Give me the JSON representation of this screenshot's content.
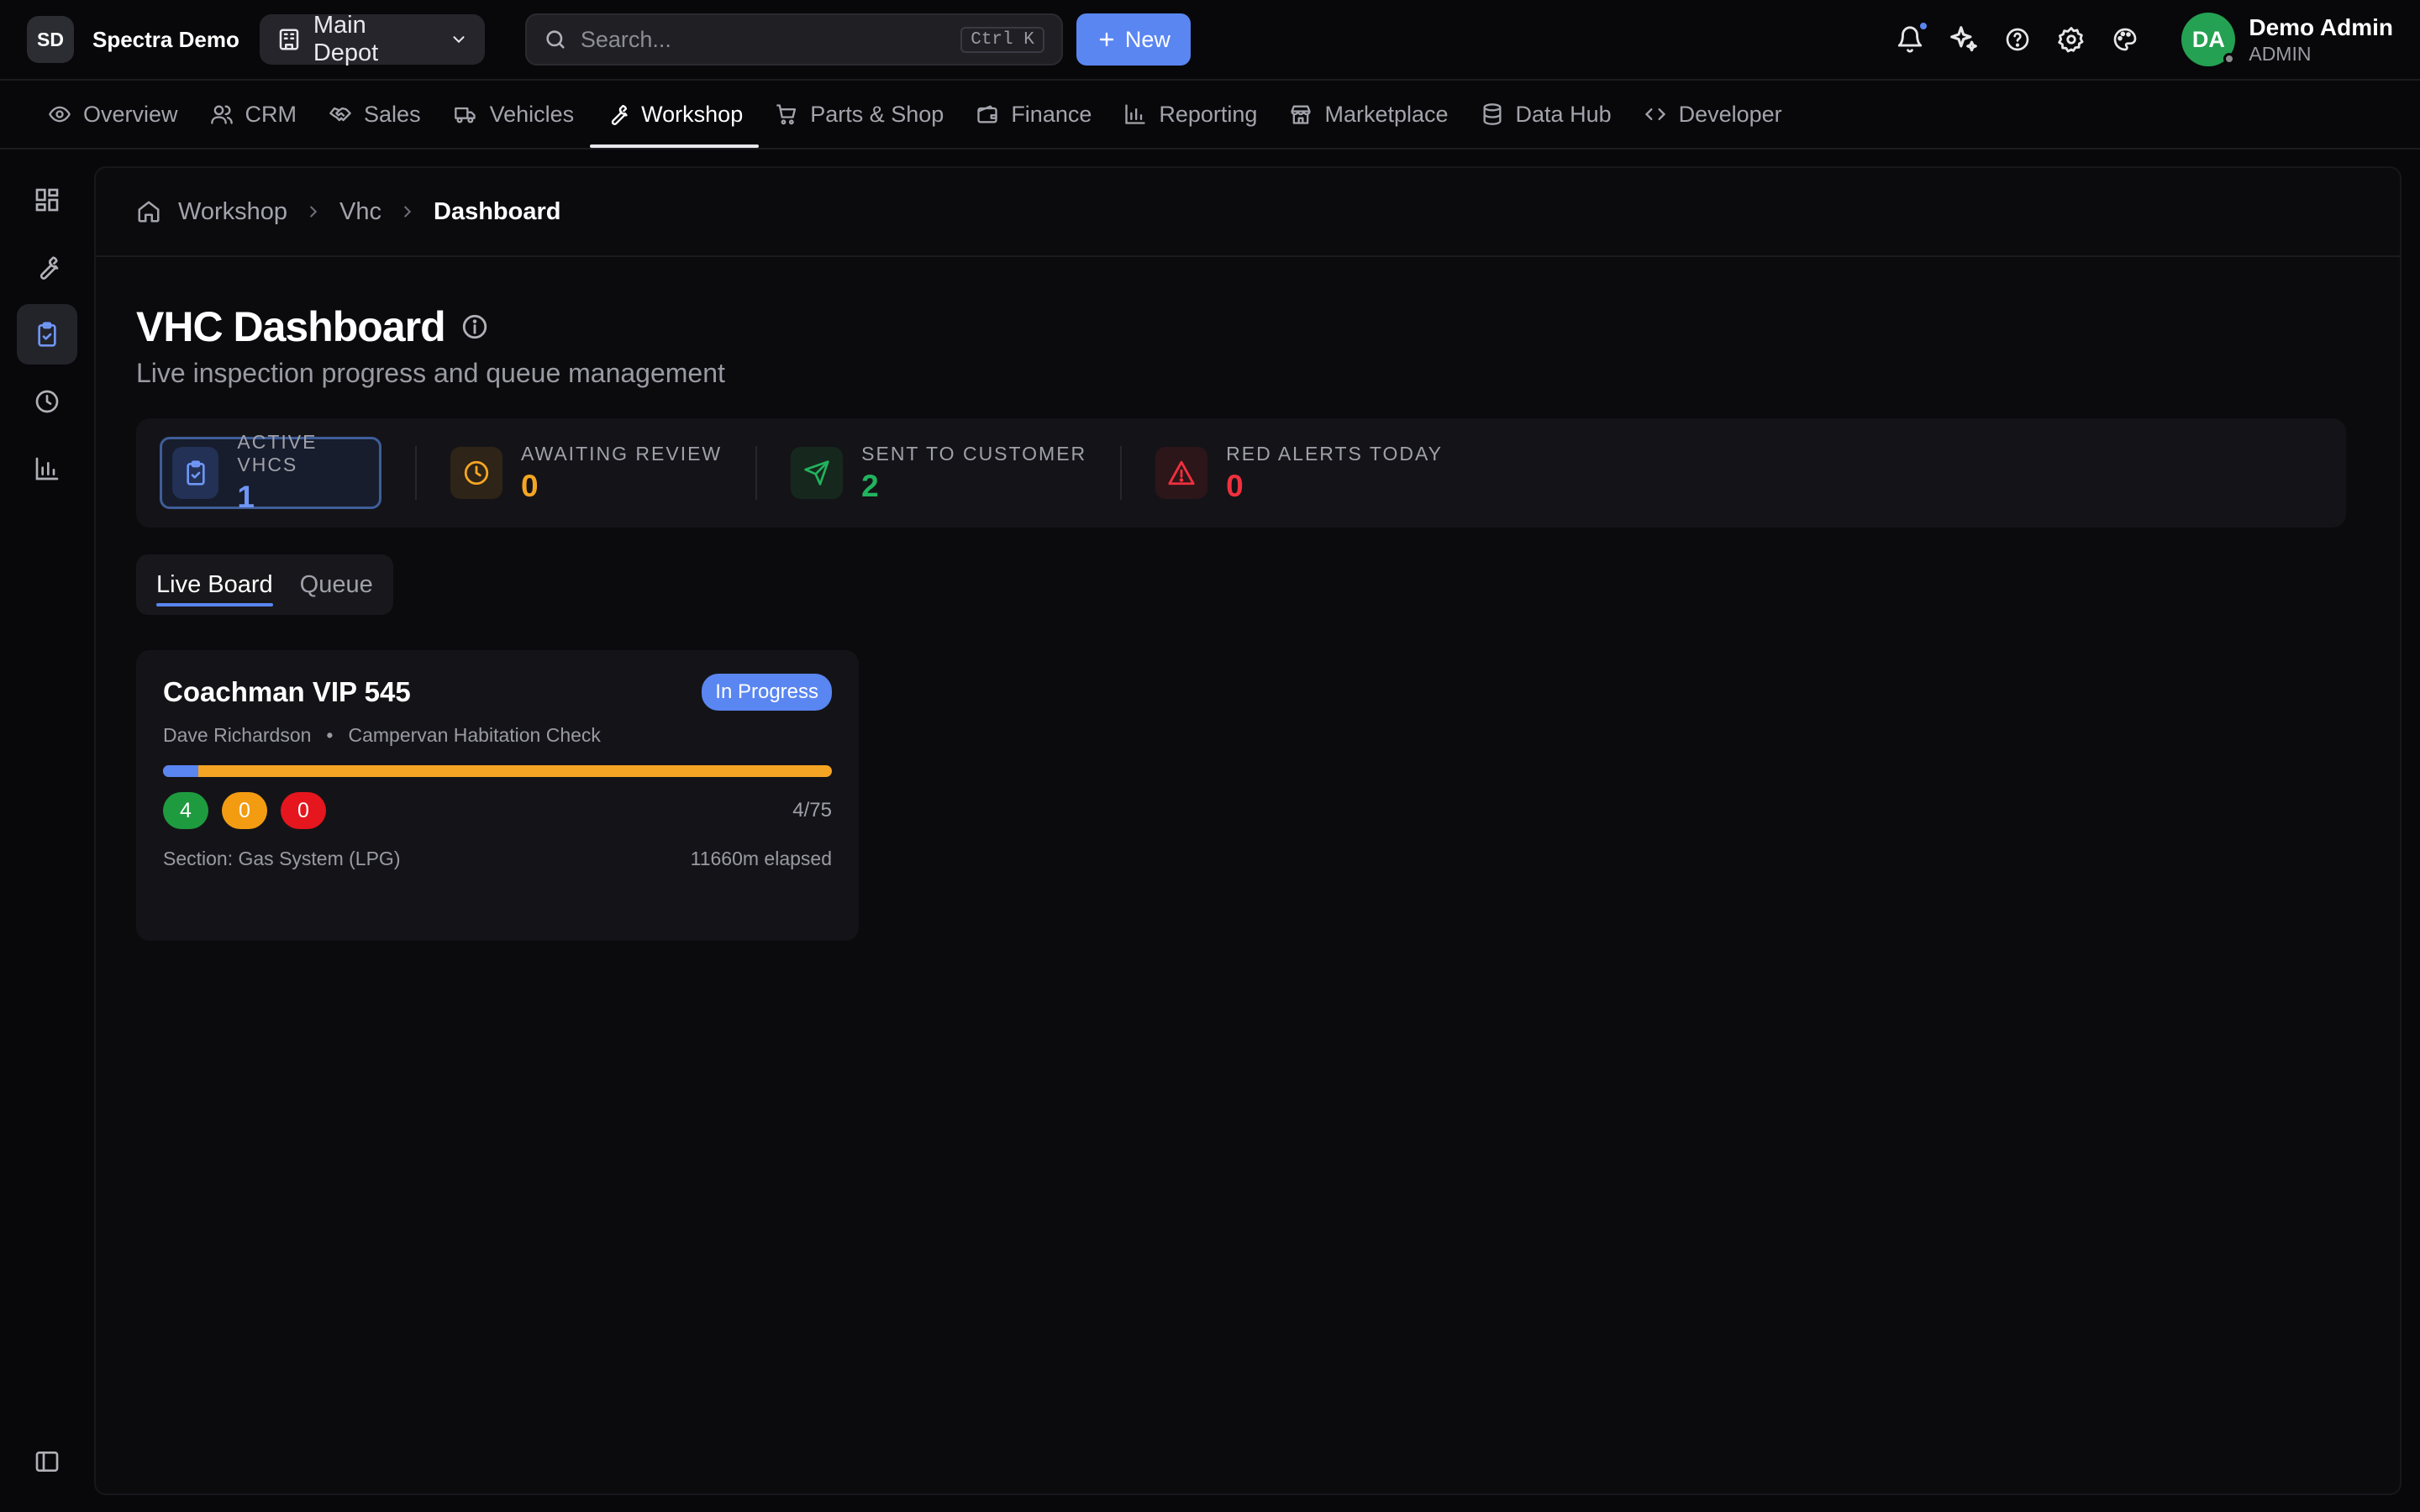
{
  "brand": {
    "initials": "SD",
    "name": "Spectra Demo"
  },
  "depot": {
    "label": "Main Depot"
  },
  "search": {
    "placeholder": "Search...",
    "shortcut": "Ctrl K"
  },
  "new_button": {
    "label": "New"
  },
  "user": {
    "initials": "DA",
    "name": "Demo Admin",
    "role": "ADMIN"
  },
  "nav": {
    "items": [
      {
        "label": "Overview",
        "icon": "eye-icon"
      },
      {
        "label": "CRM",
        "icon": "users-icon"
      },
      {
        "label": "Sales",
        "icon": "handshake-icon"
      },
      {
        "label": "Vehicles",
        "icon": "truck-icon"
      },
      {
        "label": "Workshop",
        "icon": "wrench-icon",
        "active": true
      },
      {
        "label": "Parts & Shop",
        "icon": "cart-icon"
      },
      {
        "label": "Finance",
        "icon": "wallet-icon"
      },
      {
        "label": "Reporting",
        "icon": "bar-chart-icon"
      },
      {
        "label": "Marketplace",
        "icon": "store-icon"
      },
      {
        "label": "Data Hub",
        "icon": "database-icon"
      },
      {
        "label": "Developer",
        "icon": "code-icon"
      }
    ]
  },
  "sidebar": {
    "items": [
      {
        "icon": "grid-icon"
      },
      {
        "icon": "wrench-icon"
      },
      {
        "icon": "clipboard-check-icon",
        "active": true
      },
      {
        "icon": "clock-icon"
      },
      {
        "icon": "bar-chart-icon"
      }
    ],
    "toggle_icon": "sidebar-toggle-icon"
  },
  "breadcrumb": {
    "items": [
      "Workshop",
      "Vhc",
      "Dashboard"
    ]
  },
  "page": {
    "title": "VHC Dashboard",
    "subtitle": "Live inspection progress and queue management"
  },
  "stats": [
    {
      "label": "Active VHCs",
      "value": "1",
      "color": "#5a86f2",
      "icon": "clipboard-check-icon",
      "active": true
    },
    {
      "label": "Awaiting Review",
      "value": "0",
      "color": "#f5a524",
      "icon": "clock-icon"
    },
    {
      "label": "Sent to Customer",
      "value": "2",
      "color": "#22b35e",
      "icon": "send-icon"
    },
    {
      "label": "Red Alerts Today",
      "value": "0",
      "color": "#f0303e",
      "icon": "alert-triangle-icon"
    }
  ],
  "tabs": [
    {
      "label": "Live Board",
      "active": true
    },
    {
      "label": "Queue"
    }
  ],
  "card": {
    "title": "Coachman VIP 545",
    "status": "In Progress",
    "technician": "Dave Richardson",
    "separator": "•",
    "check_type": "Campervan Habitation Check",
    "progress_fraction": 0.053,
    "green_count": "4",
    "amber_count": "0",
    "red_count": "0",
    "completed": "4/75",
    "section": "Section: Gas System (LPG)",
    "elapsed": "11660m elapsed"
  }
}
